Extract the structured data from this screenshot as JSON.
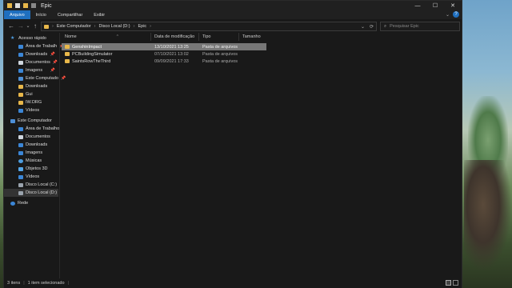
{
  "window": {
    "title": "Epic",
    "min_glyph": "—",
    "max_glyph": "☐",
    "close_glyph": "✕"
  },
  "ribbon": {
    "tabs": [
      "Arquivo",
      "Início",
      "Compartilhar",
      "Exibir"
    ],
    "collapse_glyph": "⌄",
    "help_glyph": "?"
  },
  "address": {
    "back_glyph": "←",
    "forward_glyph": "→",
    "recent_glyph": "⌄",
    "up_glyph": "↑",
    "path": [
      "Este Computador",
      "Disco Local (D:)",
      "Epic"
    ],
    "separator": "›",
    "dropdown_glyph": "⌄",
    "refresh_glyph": "⟳"
  },
  "search": {
    "icon_glyph": "⌕",
    "placeholder": "Pesquisar Epic"
  },
  "sidebar": {
    "pin_glyph": "📌",
    "quick_access": {
      "label": "Acesso rápido",
      "items": [
        {
          "label": "Área de Trabalh",
          "icon": "desktop-icon",
          "pinned": true
        },
        {
          "label": "Downloads",
          "icon": "downloads-icon",
          "pinned": true
        },
        {
          "label": "Documentos",
          "icon": "documents-icon",
          "pinned": true
        },
        {
          "label": "Imagens",
          "icon": "pictures-icon",
          "pinned": true
        },
        {
          "label": "Este Computado",
          "icon": "computer-icon",
          "pinned": true
        },
        {
          "label": "Downloads",
          "icon": "folder-icon",
          "pinned": false
        },
        {
          "label": "Gui",
          "icon": "folder-icon",
          "pinned": false
        },
        {
          "label": "IW.DRG",
          "icon": "folder-icon",
          "pinned": false
        },
        {
          "label": "Vídeos",
          "icon": "videos-icon",
          "pinned": false
        }
      ]
    },
    "this_pc": {
      "label": "Este Computador",
      "items": [
        {
          "label": "Área de Trabalho",
          "icon": "desktop-icon"
        },
        {
          "label": "Documentos",
          "icon": "documents-icon"
        },
        {
          "label": "Downloads",
          "icon": "downloads-icon"
        },
        {
          "label": "Imagens",
          "icon": "pictures-icon"
        },
        {
          "label": "Músicas",
          "icon": "music-icon"
        },
        {
          "label": "Objetos 3D",
          "icon": "3d-objects-icon"
        },
        {
          "label": "Vídeos",
          "icon": "videos-icon"
        },
        {
          "label": "Disco Local (C:)",
          "icon": "drive-icon"
        },
        {
          "label": "Disco Local (D:)",
          "icon": "drive-icon",
          "selected": true
        }
      ]
    },
    "network": {
      "label": "Rede"
    }
  },
  "columns": {
    "sort_glyph": "^",
    "name": "Nome",
    "date": "Data de modificação",
    "type": "Tipo",
    "size": "Tamanho"
  },
  "files": [
    {
      "name": "GenshinImpact",
      "date": "13/10/2021 13:25",
      "type": "Pasta de arquivos",
      "size": "",
      "selected": true
    },
    {
      "name": "PCBuildingSimulator",
      "date": "07/10/2021 13:02",
      "type": "Pasta de arquivos",
      "size": "",
      "selected": false
    },
    {
      "name": "SaintsRowTheThird",
      "date": "09/09/2021 17:33",
      "type": "Pasta de arquivos",
      "size": "",
      "selected": false
    }
  ],
  "status": {
    "count": "3 itens",
    "selection": "1 item selecionado",
    "separator": "|"
  },
  "colors": {
    "accent": "#1f6fbf",
    "folder": "#e8b74a",
    "selection": "#777777"
  }
}
